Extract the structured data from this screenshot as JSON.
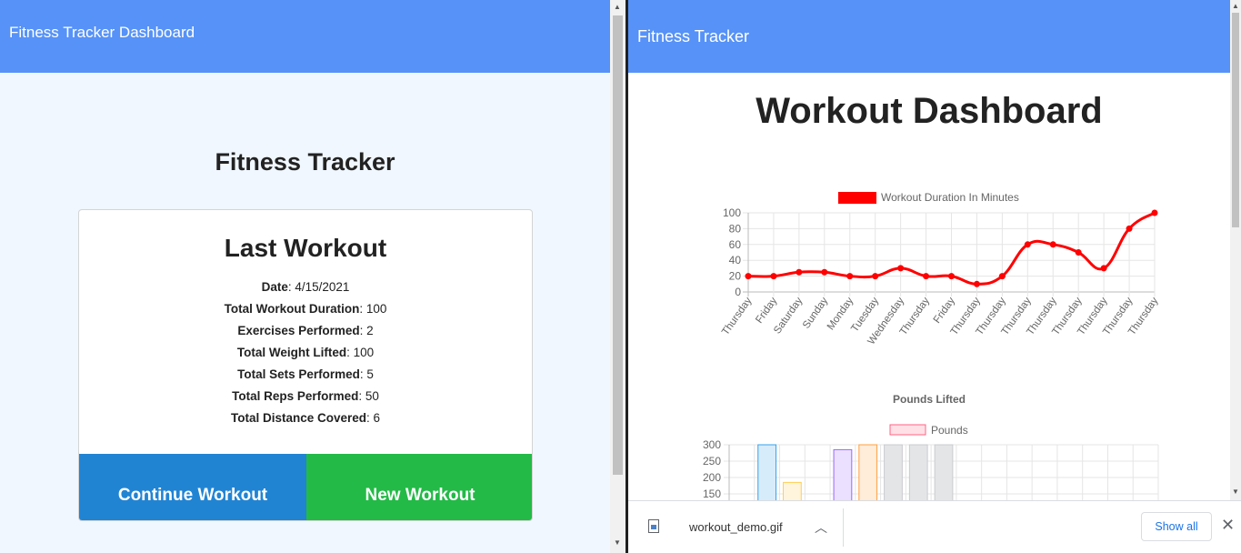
{
  "left": {
    "header_title": "Fitness Tracker Dashboard",
    "page_title": "Fitness Tracker",
    "card": {
      "title": "Last Workout",
      "stats": [
        {
          "label": "Date",
          "value": ": 4/15/2021"
        },
        {
          "label": "Total Workout Duration",
          "value": ": 100"
        },
        {
          "label": "Exercises Performed",
          "value": ": 2"
        },
        {
          "label": "Total Weight Lifted",
          "value": ": 100"
        },
        {
          "label": "Total Sets Performed",
          "value": ": 5"
        },
        {
          "label": "Total Reps Performed",
          "value": ": 50"
        },
        {
          "label": "Total Distance Covered",
          "value": ": 6"
        }
      ],
      "continue_label": "Continue Workout",
      "new_label": "New Workout"
    }
  },
  "right": {
    "header_title": "Fitness Tracker",
    "page_title": "Workout Dashboard"
  },
  "download_bar": {
    "file_name": "workout_demo.gif",
    "show_all_label": "Show all",
    "file_icon": "image-file-icon"
  },
  "colors": {
    "header": "#5692f7",
    "continue_button": "#2184d3",
    "new_button": "#23ba47",
    "line_series": "#ff0000"
  },
  "chart_data": [
    {
      "type": "line",
      "categories": [
        "Thursday",
        "Friday",
        "Saturday",
        "Sunday",
        "Monday",
        "Tuesday",
        "Wednesday",
        "Thursday",
        "Friday",
        "Thursday",
        "Thursday",
        "Thursday",
        "Thursday",
        "Thursday",
        "Thursday",
        "Thursday",
        "Thursday"
      ],
      "series": [
        {
          "name": "Workout Duration In Minutes",
          "color": "#ff0000",
          "values": [
            20,
            20,
            25,
            25,
            20,
            20,
            30,
            20,
            20,
            10,
            20,
            60,
            60,
            50,
            30,
            80,
            100
          ]
        }
      ],
      "ylim": [
        0,
        100
      ],
      "yticks": [
        0,
        20,
        40,
        60,
        80,
        100
      ],
      "grid": true,
      "legend": "top"
    },
    {
      "type": "bar",
      "title": "Pounds Lifted",
      "series": [
        {
          "name": "Pounds",
          "values": [
            null,
            300,
            185,
            null,
            285,
            300,
            300,
            300,
            300
          ]
        }
      ],
      "bar_colors": [
        "#36a2eb",
        "#36a2eb",
        "#ffce56",
        "#9966ff",
        "#9966ff",
        "#ff9f40",
        "#c9cbcf",
        "#c9cbcf",
        "#c9cbcf"
      ],
      "yticks": [
        150,
        200,
        250,
        300
      ],
      "grid": true,
      "legend": "top"
    }
  ]
}
